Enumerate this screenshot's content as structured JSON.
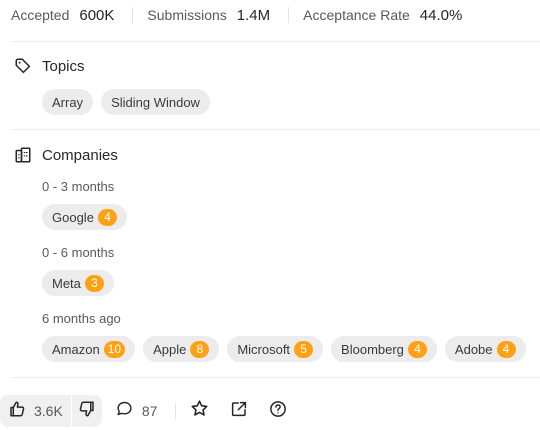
{
  "stats": [
    {
      "label": "Accepted",
      "value": "600K"
    },
    {
      "label": "Submissions",
      "value": "1.4M"
    },
    {
      "label": "Acceptance Rate",
      "value": "44.0%"
    }
  ],
  "topics": {
    "title": "Topics",
    "tags": [
      "Array",
      "Sliding Window"
    ]
  },
  "companies": {
    "title": "Companies",
    "groups": [
      {
        "period": "0 - 3 months",
        "items": [
          {
            "name": "Google",
            "count": "4"
          }
        ]
      },
      {
        "period": "0 - 6 months",
        "items": [
          {
            "name": "Meta",
            "count": "3"
          }
        ]
      },
      {
        "period": "6 months ago",
        "items": [
          {
            "name": "Amazon",
            "count": "10"
          },
          {
            "name": "Apple",
            "count": "8"
          },
          {
            "name": "Microsoft",
            "count": "5"
          },
          {
            "name": "Bloomberg",
            "count": "4"
          },
          {
            "name": "Adobe",
            "count": "4"
          }
        ]
      }
    ]
  },
  "footer": {
    "likes": "3.6K",
    "comments": "87"
  },
  "colors": {
    "badge": "#ffa116",
    "chip_bg": "#ececec"
  },
  "icons": [
    "tag-icon",
    "building-icon",
    "thumbs-up-icon",
    "thumbs-down-icon",
    "comment-icon",
    "star-icon",
    "share-icon",
    "help-icon"
  ]
}
